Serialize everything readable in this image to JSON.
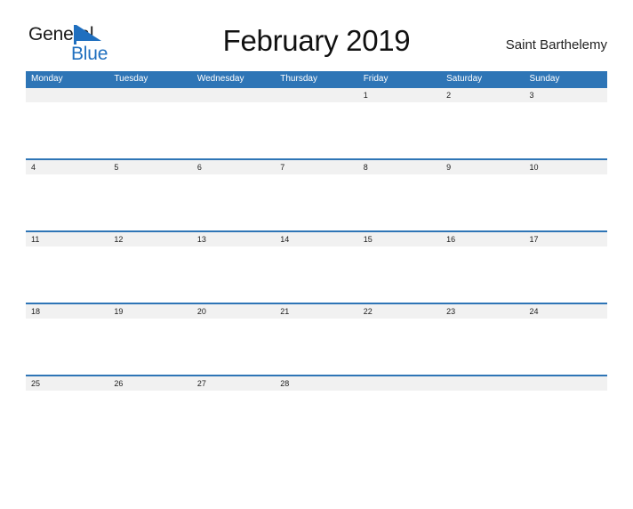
{
  "brand": {
    "line1": "General",
    "line2": "Blue",
    "flag_icon": "blue-flag-triangle-icon",
    "line2_color": "#1f6fbf",
    "flag_color": "#1f6fbf"
  },
  "header": {
    "title": "February 2019",
    "location": "Saint Barthelemy"
  },
  "calendar": {
    "accent_color": "#2e75b6",
    "date_band_color": "#f1f1f1",
    "weekdays": [
      "Monday",
      "Tuesday",
      "Wednesday",
      "Thursday",
      "Friday",
      "Saturday",
      "Sunday"
    ],
    "weeks": [
      [
        "",
        "",
        "",
        "",
        "1",
        "2",
        "3"
      ],
      [
        "4",
        "5",
        "6",
        "7",
        "8",
        "9",
        "10"
      ],
      [
        "11",
        "12",
        "13",
        "14",
        "15",
        "16",
        "17"
      ],
      [
        "18",
        "19",
        "20",
        "21",
        "22",
        "23",
        "24"
      ],
      [
        "25",
        "26",
        "27",
        "28",
        "",
        "",
        ""
      ]
    ]
  }
}
